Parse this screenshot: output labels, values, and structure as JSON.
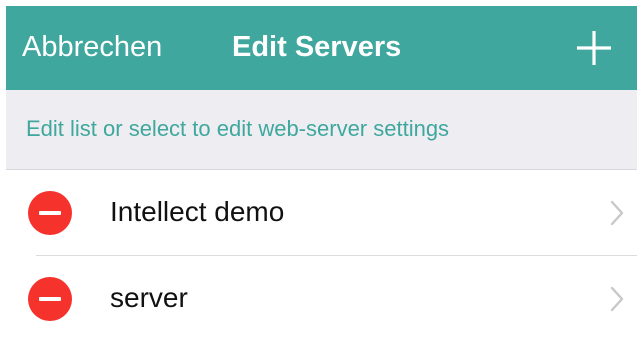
{
  "navbar": {
    "cancel_label": "Abbrechen",
    "title": "Edit Servers",
    "add_icon": "plus-icon",
    "color": "#3fa79d"
  },
  "hint": {
    "text": "Edit list or select to edit web-server settings"
  },
  "servers": [
    {
      "name": "Intellect demo"
    },
    {
      "name": "server"
    }
  ],
  "colors": {
    "accent": "#3fa79d",
    "delete": "#f5322c",
    "hint_background": "#eeeef2"
  }
}
